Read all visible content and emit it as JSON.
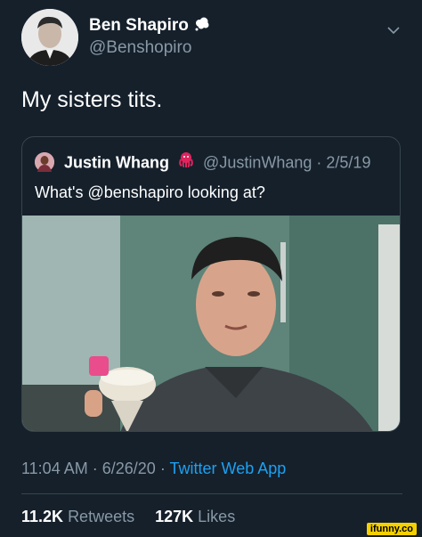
{
  "author": {
    "display_name": "Ben Shapiro",
    "handle": "@Benshopiro",
    "name_emoji": "thought-balloon-icon"
  },
  "tweet": {
    "text": "My sisters tits."
  },
  "quoted_tweet": {
    "display_name": "Justin Whang",
    "name_emoji": "octopus-icon",
    "handle": "@JustinWhang",
    "separator": "·",
    "date": "2/5/19",
    "text": "What's @benshapiro looking at?"
  },
  "meta": {
    "time": "11:04 AM",
    "separator": "·",
    "date": "6/26/20",
    "separator2": "·",
    "app": "Twitter Web App"
  },
  "stats": {
    "retweets_count": "11.2K",
    "retweets_label": "Retweets",
    "likes_count": "127K",
    "likes_label": "Likes"
  },
  "watermark": "ifunny.co",
  "colors": {
    "background": "#15202b",
    "secondary_text": "#8899a6",
    "link": "#1da1f2",
    "border": "#38444d"
  }
}
